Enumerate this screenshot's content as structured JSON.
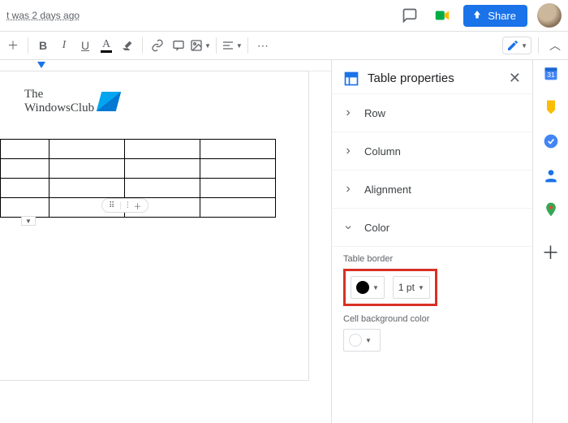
{
  "meta": {
    "last_edit": "t was 2 days ago"
  },
  "header": {
    "share_label": "Share"
  },
  "brand": {
    "line1": "The",
    "line2": "WindowsClub"
  },
  "panel": {
    "title": "Table properties",
    "sections": {
      "row": "Row",
      "column": "Column",
      "alignment": "Alignment",
      "color": "Color"
    },
    "border_label": "Table border",
    "border_width": "1 pt",
    "bg_label": "Cell background color"
  }
}
